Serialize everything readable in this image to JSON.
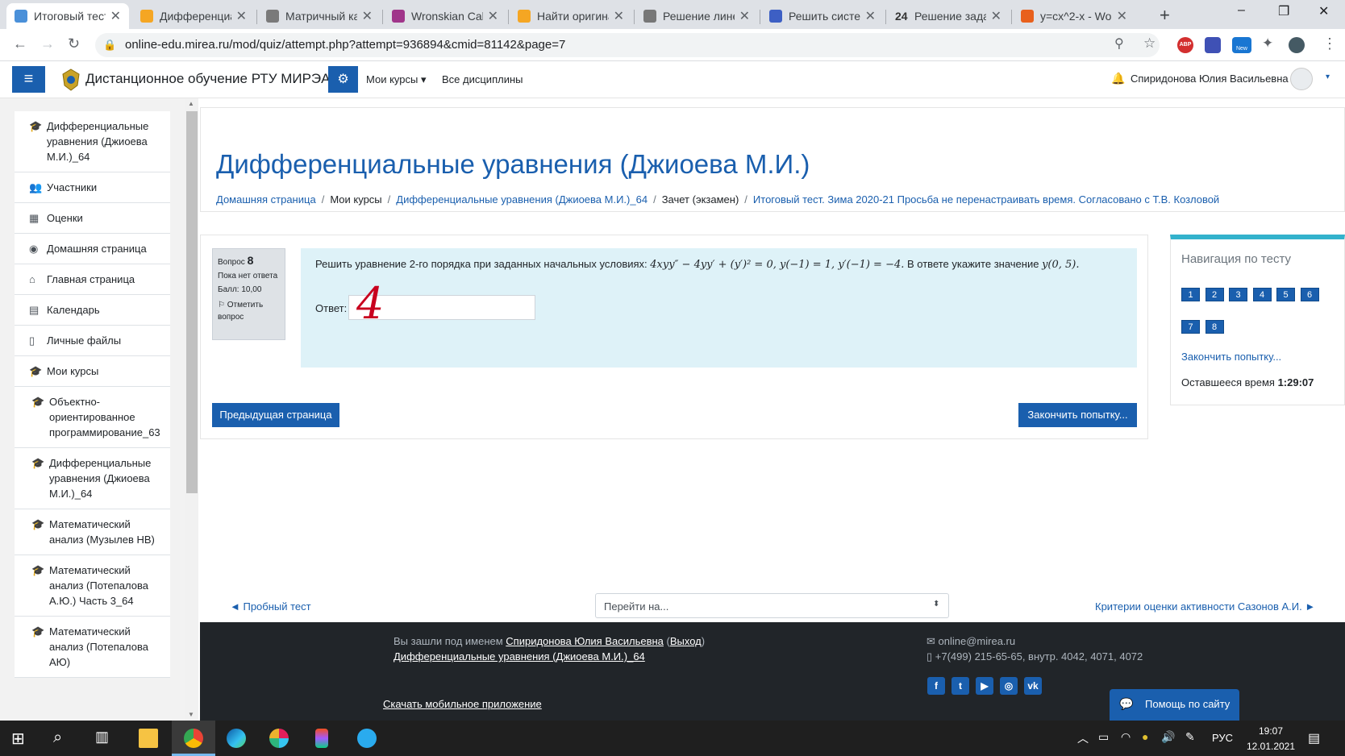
{
  "browser": {
    "tabs": [
      {
        "title": "Итоговый тест",
        "color": "#4a90d9",
        "active": true
      },
      {
        "title": "Дифференциа",
        "color": "#f5a623"
      },
      {
        "title": "Матричный ка",
        "color": "#7a7a7a"
      },
      {
        "title": "Wronskian Calc",
        "color": "#a0358a"
      },
      {
        "title": "Найти оригина",
        "color": "#f5a623"
      },
      {
        "title": "Решение лине",
        "color": "#777777"
      },
      {
        "title": "Решить систем",
        "color": "#3d5fc4"
      },
      {
        "title": "Решение зада",
        "color": "#333333",
        "glyph": "24"
      },
      {
        "title": "y=cx^2-x - Wo",
        "color": "#e8601c"
      }
    ],
    "new_tab": "+",
    "url": "online-edu.mirea.ru/mod/quiz/attempt.php?attempt=936894&cmid=81142&page=7",
    "window_controls": [
      "–",
      "❐",
      "✕"
    ],
    "ext_abp_label": "ABP",
    "ext_new_label": "New"
  },
  "navbar": {
    "site_name": "Дистанционное обучение РТУ МИРЭА",
    "my_courses": "Мои курсы",
    "all_disciplines": "Все дисциплины",
    "user_name": "Спиридонова Юлия Васильевна"
  },
  "drawer": {
    "items": [
      {
        "label": "Дифференциальные уравнения (Джиоева М.И.)_64",
        "icon": "graduation-cap-icon",
        "glyph": "🎓"
      },
      {
        "label": "Участники",
        "icon": "users-icon",
        "glyph": "👥"
      },
      {
        "label": "Оценки",
        "icon": "table-icon",
        "glyph": "▦"
      },
      {
        "label": "Домашняя страница",
        "icon": "dashboard-icon",
        "glyph": "◉"
      },
      {
        "label": "Главная страница",
        "icon": "home-icon",
        "glyph": "⌂"
      },
      {
        "label": "Календарь",
        "icon": "calendar-icon",
        "glyph": "▤"
      },
      {
        "label": "Личные файлы",
        "icon": "file-icon",
        "glyph": "▯"
      },
      {
        "label": "Мои курсы",
        "icon": "graduation-cap-icon",
        "glyph": "🎓"
      },
      {
        "label": "Объектно-ориентированное программирование_63",
        "icon": "graduation-cap-icon",
        "glyph": "🎓",
        "sub": true
      },
      {
        "label": "Дифференциальные уравнения (Джиоева М.И.)_64",
        "icon": "graduation-cap-icon",
        "glyph": "🎓",
        "sub": true
      },
      {
        "label": "Математический анализ (Музылев НВ)",
        "icon": "graduation-cap-icon",
        "glyph": "🎓",
        "sub": true
      },
      {
        "label": "Математический анализ (Потепалова А.Ю.) Часть 3_64",
        "icon": "graduation-cap-icon",
        "glyph": "🎓",
        "sub": true
      },
      {
        "label": "Математический анализ (Потепалова АЮ)",
        "icon": "graduation-cap-icon",
        "glyph": "🎓",
        "sub": true
      }
    ]
  },
  "page": {
    "title": "Дифференциальные уравнения (Джиоева М.И.)",
    "breadcrumb": [
      {
        "label": "Домашняя страница",
        "link": true
      },
      {
        "label": "Мои курсы",
        "link": false
      },
      {
        "label": "Дифференциальные уравнения (Джиоева М.И.)_64",
        "link": true
      },
      {
        "label": "Зачет (экзамен)",
        "link": false
      },
      {
        "label": "Итоговый тест. Зима 2020-21 Просьба не перенастраивать время. Согласовано с Т.В. Козловой",
        "link": true
      }
    ]
  },
  "question": {
    "label": "Вопрос",
    "number": "8",
    "status": "Пока нет ответа",
    "grade": "Балл: 10,00",
    "flag": "Отметить вопрос",
    "text_before": "Решить уравнение 2-го порядка при заданных начальных условиях: ",
    "formula": "4xyy″ − 4yy′ + (y′)² = 0, y(−1) = 1, y′(−1) = −4.",
    "text_after": " В ответе укажите значение ",
    "formula2": "y(0, 5).",
    "answer_label": "Ответ:",
    "handwritten": "4",
    "prev_button": "Предыдущая страница",
    "finish_button": "Закончить попытку..."
  },
  "quiz_nav": {
    "title": "Навигация по тесту",
    "buttons": [
      "1",
      "2",
      "3",
      "4",
      "5",
      "6",
      "7",
      "8"
    ],
    "finish_link": "Закончить попытку...",
    "time_label": "Оставшееся время ",
    "time_value": "1:29:07"
  },
  "activity_nav": {
    "prev": "◄ Пробный тест",
    "jump_placeholder": "Перейти на...",
    "next": "Критерии оценки активности Сазонов А.И. ►"
  },
  "footer": {
    "logged_in_as": "Вы зашли под именем ",
    "user_link": "Спиридонова Юлия Васильевна",
    "logout": "Выход",
    "course_link": "Дифференциальные уравнения (Джиоева М.И.)_64",
    "mobile_app": "Скачать мобильное приложение",
    "email": "online@mirea.ru",
    "phone": "+7(499) 215-65-65, внутр. 4042, 4071, 4072",
    "social": [
      "f",
      "t",
      "▶",
      "◎",
      "vk"
    ],
    "help": "Помощь по сайту"
  },
  "taskbar": {
    "lang": "РУС",
    "time": "19:07",
    "date": "12.01.2021"
  }
}
